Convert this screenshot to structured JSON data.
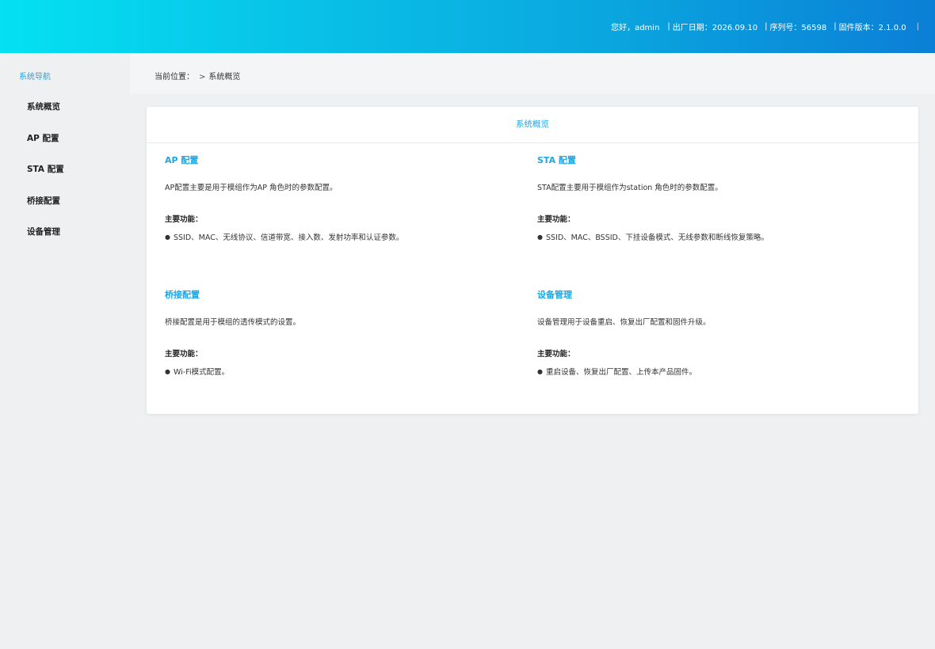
{
  "header": {
    "greeting": "您好，admin",
    "date_label": "出厂日期：2026.09.10",
    "serial_label": "序列号：56598",
    "firmware_label": "固件版本：2.1.0.0",
    "separator": "|"
  },
  "sidebar": {
    "title": "系统导航",
    "items": [
      {
        "label": "系统概览"
      },
      {
        "label": "AP 配置"
      },
      {
        "label": "STA 配置"
      },
      {
        "label": "桥接配置"
      },
      {
        "label": "设备管理"
      }
    ]
  },
  "breadcrumb": {
    "prefix": "当前位置：",
    "chevron": ">",
    "current": "系统概览"
  },
  "main": {
    "card_title": "系统概览",
    "sections": [
      {
        "title": "AP 配置",
        "desc": "AP配置主要是用于模组作为AP 角色时的参数配置。",
        "func_label": "主要功能：",
        "func_item": "SSID、MAC、无线协议、信道带宽、接入数、发射功率和认证参数。"
      },
      {
        "title": "STA 配置",
        "desc": "STA配置主要用于模组作为station 角色时的参数配置。",
        "func_label": "主要功能：",
        "func_item": "SSID、MAC、BSSID、下挂设备模式、无线参数和断线恢复策略。"
      },
      {
        "title": "桥接配置",
        "desc": "桥接配置是用于模组的透传模式的设置。",
        "func_label": "主要功能：",
        "func_item": "Wi-Fi模式配置。"
      },
      {
        "title": "设备管理",
        "desc": "设备管理用于设备重启、恢复出厂配置和固件升级。",
        "func_label": "主要功能：",
        "func_item": "重启设备、恢复出厂配置、上传本产品固件。"
      }
    ],
    "bullet": "●"
  },
  "colors": {
    "accent": "#1ea7e4",
    "header_gradient_start": "#04e1f2",
    "header_gradient_end": "#0b7fd6",
    "background": "#eef0f2"
  }
}
